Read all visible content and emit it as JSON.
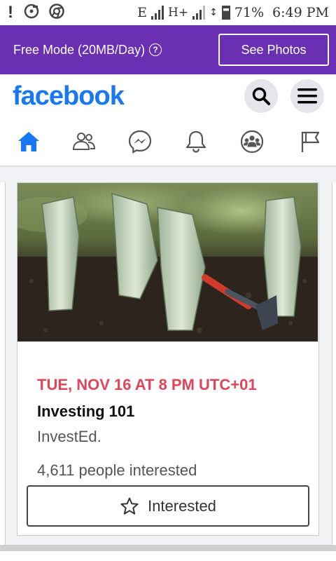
{
  "status_bar": {
    "network_type": "E",
    "network_type_2": "H+",
    "battery_percent": "71%",
    "time": "6:49 PM",
    "icons": [
      "alert-icon",
      "music-disc-icon",
      "chrome-icon",
      "signal-icon",
      "battery-icon"
    ]
  },
  "banner": {
    "label": "Free Mode (20MB/Day)",
    "button": "See Photos",
    "background": "#6b2fb3"
  },
  "header": {
    "logo": "facebook",
    "logo_color": "#1877f2"
  },
  "nav": {
    "tabs": [
      "home-icon",
      "friends-icon",
      "messenger-icon",
      "notifications-icon",
      "groups-icon",
      "pages-flag-icon"
    ],
    "active": "home-icon"
  },
  "event": {
    "date": "TUE, NOV 16 AT 8 PM UTC+01",
    "title": "Investing 101",
    "host": "InvestEd.",
    "interest": "4,611 people interested",
    "button_label": "Interested",
    "date_color": "#e0455a"
  }
}
